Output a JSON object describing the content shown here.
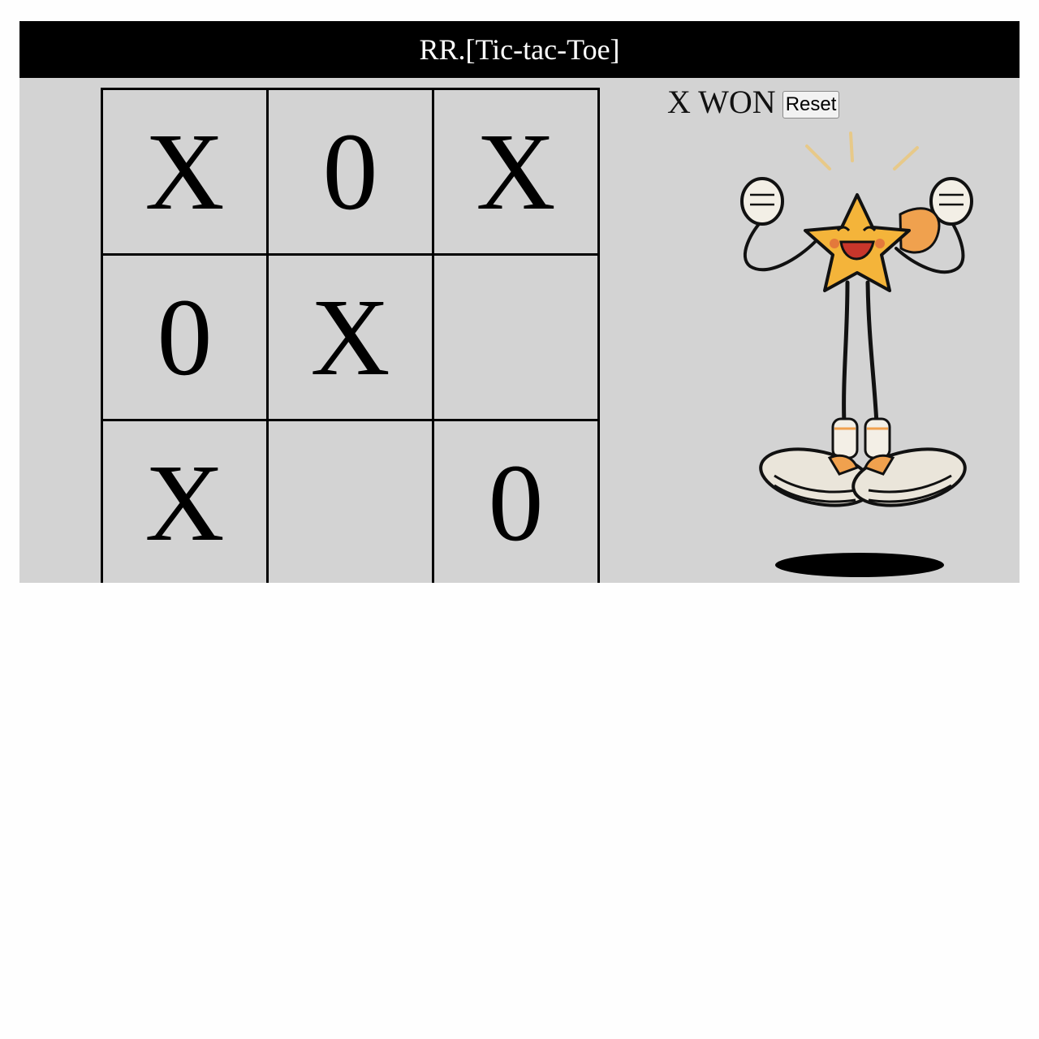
{
  "header": {
    "title": "RR.[Tic-tac-Toe]"
  },
  "board": {
    "cells": [
      "X",
      "0",
      "X",
      "0",
      "X",
      "",
      "X",
      "",
      "0"
    ]
  },
  "status": {
    "text": "X WON",
    "reset_label": "Reset"
  },
  "colors": {
    "header_bg": "#000000",
    "board_bg": "#d3d3d3",
    "star_fill": "#f4b43a"
  },
  "mascot": {
    "icon": "celebrating-star-mascot-icon"
  }
}
